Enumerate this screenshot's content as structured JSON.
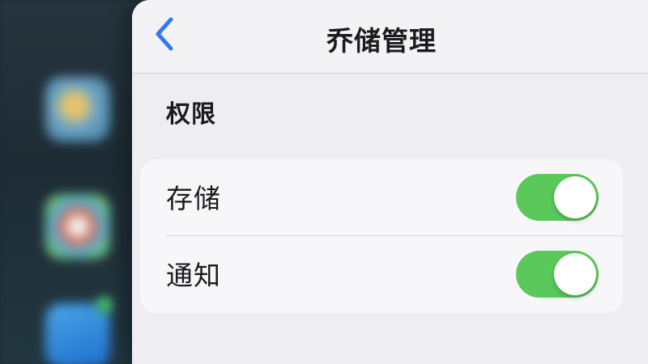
{
  "navbar": {
    "title": "乔储管理",
    "back_icon": "chevron-left-icon"
  },
  "section": {
    "header": "权限"
  },
  "permissions": [
    {
      "label": "存储",
      "enabled": true
    },
    {
      "label": "通知",
      "enabled": true
    }
  ],
  "colors": {
    "accent": "#3478f6",
    "toggle_on": "#5ac85a",
    "sheet_bg": "#eeedf2",
    "group_bg": "#f7f7f9"
  }
}
